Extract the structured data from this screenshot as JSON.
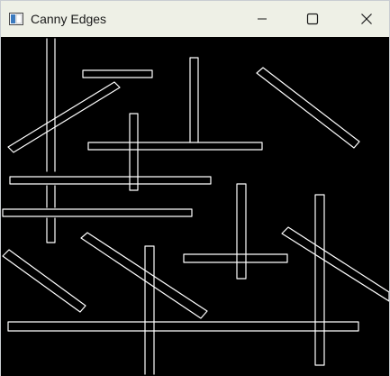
{
  "window": {
    "title": "Canny Edges",
    "icon": "window-app-icon",
    "controls": {
      "minimize_icon": "minimize-icon",
      "maximize_icon": "maximize-icon",
      "close_icon": "close-icon"
    }
  },
  "canvas": {
    "background": "#000000",
    "edge_color": "#ffffff"
  },
  "colors": {
    "titlebar_bg": "#eef0e6",
    "title_text": "#1a1a1a"
  }
}
